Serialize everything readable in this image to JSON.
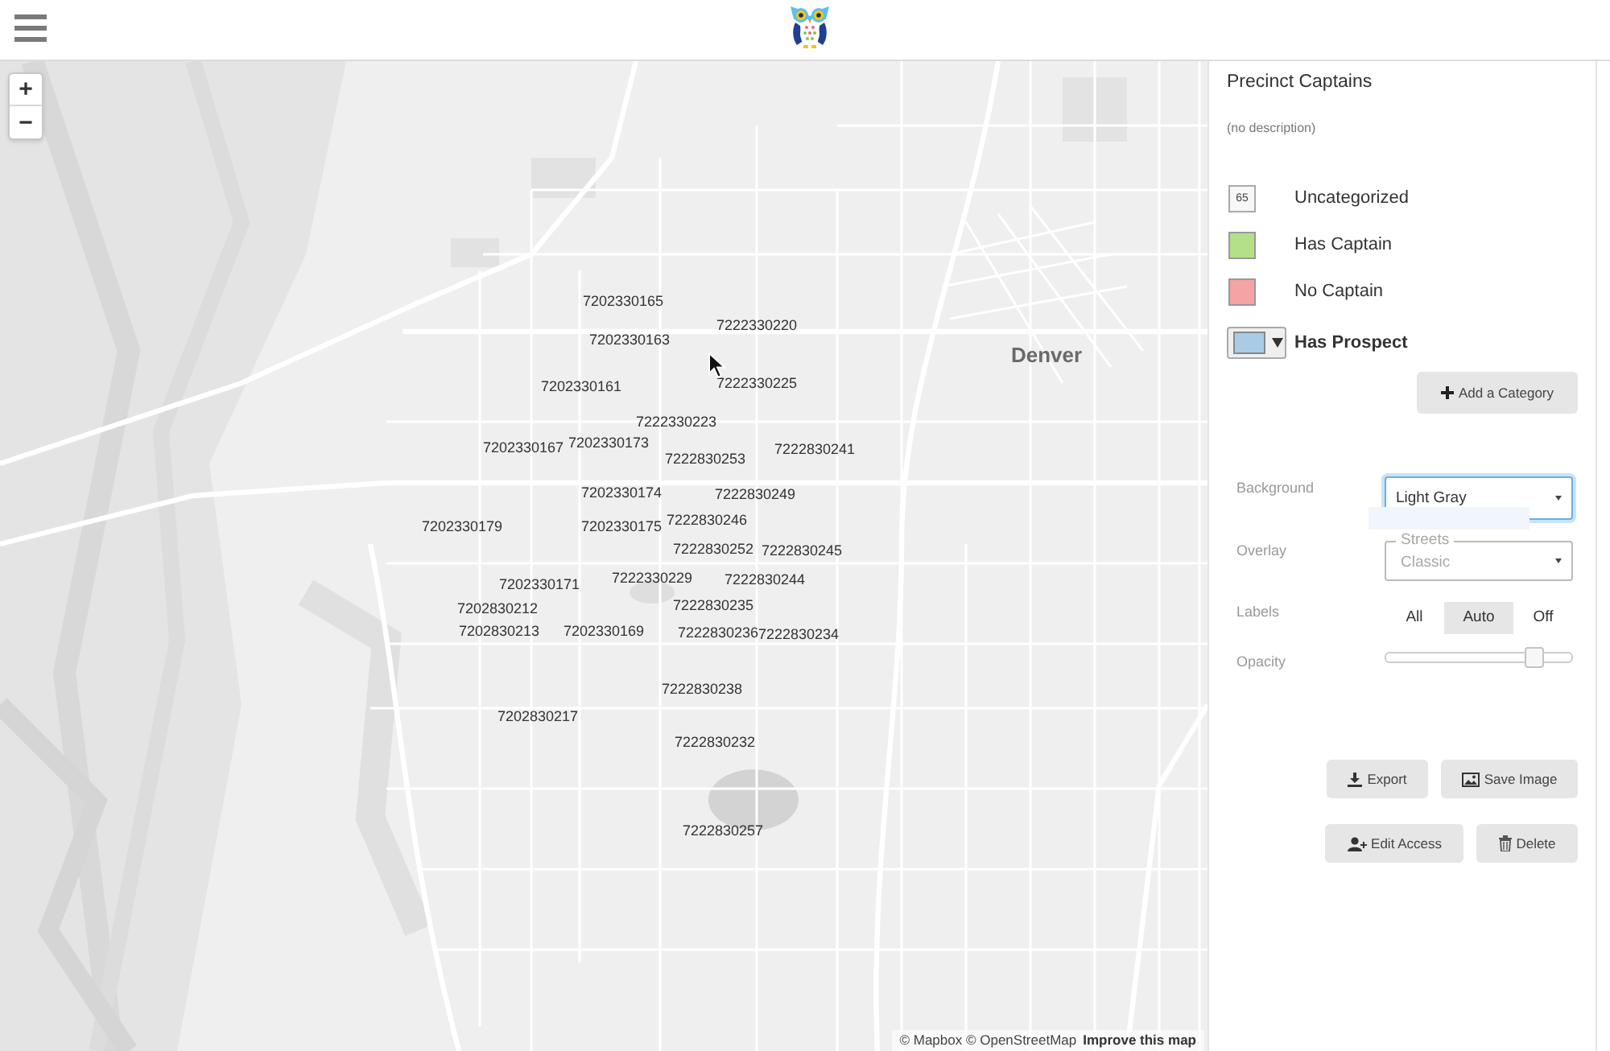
{
  "map": {
    "zoom_buttons": [
      "+",
      "−"
    ],
    "city_label": "Denver",
    "precinct_labels": [
      "7202330165",
      "7222330220",
      "7202330163",
      "7202330161",
      "7222330225",
      "7222330223",
      "7202330167",
      "7202330173",
      "7222830253",
      "7222830241",
      "7202330174",
      "7222830249",
      "7202330179",
      "7202330175",
      "7222830246",
      "7222830252",
      "7222830245",
      "7202330171",
      "7222330229",
      "7222830244",
      "7202830212",
      "7222830235",
      "7202830213",
      "7202330169",
      "7222830236",
      "7222830234",
      "7222830238",
      "7202830217",
      "7222830232",
      "7222830257"
    ],
    "attribution": {
      "text": "© Mapbox © OpenStreetMap",
      "link": "Improve this map"
    }
  },
  "panel": {
    "title": "Precinct Captains",
    "description": "(no description)",
    "categories": [
      {
        "label": "Uncategorized",
        "count": "65",
        "color": "#f7f7f7",
        "selected": false
      },
      {
        "label": "Has Captain",
        "color": "#b5e08a",
        "selected": false
      },
      {
        "label": "No Captain",
        "color": "#f5a3a3",
        "selected": false
      },
      {
        "label": "Has Prospect",
        "color": "#a9cbe6",
        "selected": true
      }
    ],
    "add_button": "Add a Category",
    "settings": {
      "background": {
        "label": "Background",
        "value": "Light Gray",
        "focused": true
      },
      "overlay": {
        "label": "Overlay",
        "focused": false,
        "fading_options": [
          "Streets",
          "Classic"
        ]
      },
      "labels": {
        "label": "Labels",
        "options": [
          {
            "label": "All",
            "selected": false
          },
          {
            "label": "Auto",
            "selected": true
          },
          {
            "label": "Off",
            "selected": false
          }
        ]
      },
      "opacity": {
        "label": "Opacity",
        "level": 0.82
      }
    },
    "actions": [
      {
        "label": "Export"
      },
      {
        "label": "Save Image"
      },
      {
        "label": "Edit Access"
      },
      {
        "label": "Delete"
      }
    ]
  }
}
